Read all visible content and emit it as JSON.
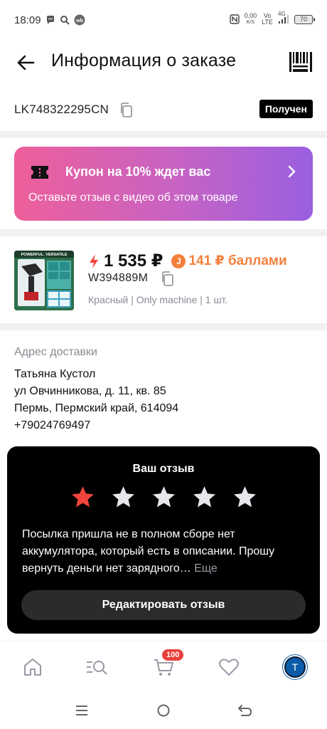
{
  "status_bar": {
    "time": "18:09",
    "net_speed_value": "0,00",
    "net_speed_unit": "K/S",
    "volte_top": "Vo",
    "volte_bottom": "LTE",
    "network": "4G",
    "battery": "70"
  },
  "header": {
    "title": "Информация о заказе"
  },
  "order": {
    "id": "LK748322295CN",
    "status": "Получен"
  },
  "coupon": {
    "title": "Купон на 10% ждет вас",
    "subtitle": "Оставьте отзыв с видео об этом товаре",
    "gradient_start": "#ee5f9a",
    "gradient_end": "#9a5fe0"
  },
  "product": {
    "price": "1 535 ₽",
    "points": "141 ₽ баллами",
    "points_coin_letter": "J",
    "sku": "W394889M",
    "variant": "Красный | Only machine | 1 шт.",
    "image_caption": "POWERFUL. VERSATILE"
  },
  "address": {
    "label": "Адрес доставки",
    "name": "Татьяна Кустол",
    "street": "ул Овчинникова, д. 11, кв. 85",
    "city": "Пермь, Пермский край, 614094",
    "phone": "+79024769497"
  },
  "review": {
    "title": "Ваш отзыв",
    "rating": 1,
    "max_rating": 5,
    "text": "Посылка пришла не в полном сборе нет аккумулятора, который есть в описании. Прошу вернуть деньги нет зарядного…",
    "more_label": "Еще",
    "edit_label": "Редактировать отзыв",
    "star_active_color": "#f0453c",
    "star_inactive_color": "#e6e6ec"
  },
  "bottom_nav": {
    "cart_count": "100",
    "avatar_letter": "Т",
    "icons": [
      "home-icon",
      "catalog-search-icon",
      "cart-icon",
      "heart-icon",
      "profile-avatar"
    ]
  },
  "colors": {
    "accent_orange": "#f4803c",
    "price_bolt": "#f0453c",
    "badge_red": "#e8403c"
  }
}
